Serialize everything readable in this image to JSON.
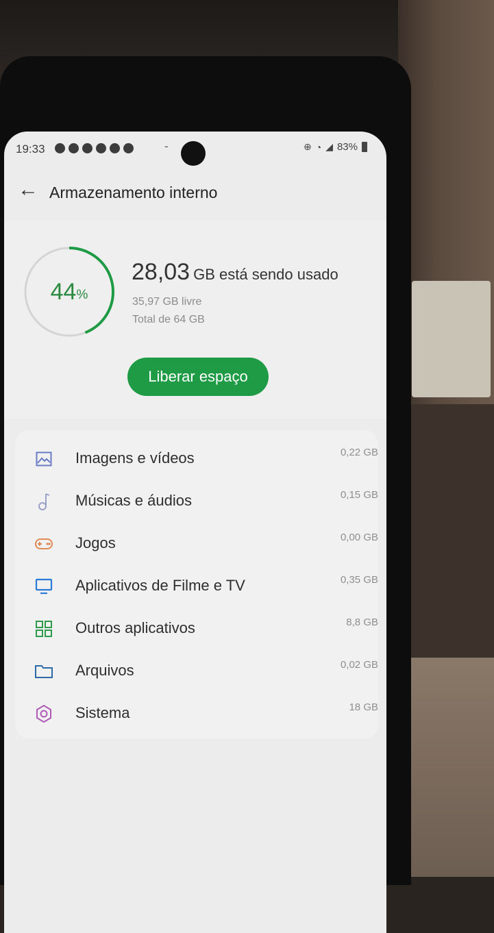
{
  "status_bar": {
    "time": "19:33",
    "separator": "-",
    "battery": "83%"
  },
  "header": {
    "title": "Armazenamento interno"
  },
  "summary": {
    "percent_value": "44",
    "percent_sign": "%",
    "used_amount": "28,03",
    "used_text": "GB está sendo usado",
    "free_text": "35,97 GB livre",
    "total_text": "Total de 64 GB",
    "used_fraction": 0.44,
    "free_space_button": "Liberar espaço"
  },
  "categories": [
    {
      "label": "Imagens e vídeos",
      "size": "0,22 GB",
      "icon": "image-icon",
      "color": "#6b7bc6"
    },
    {
      "label": "Músicas e áudios",
      "size": "0,15 GB",
      "icon": "music-note-icon",
      "color": "#9aa0c8"
    },
    {
      "label": "Jogos",
      "size": "0,00 GB",
      "icon": "gamepad-icon",
      "color": "#e08a56"
    },
    {
      "label": "Aplicativos de Filme e TV",
      "size": "0,35 GB",
      "icon": "tv-icon",
      "color": "#2b7bd6"
    },
    {
      "label": "Outros aplicativos",
      "size": "8,8 GB",
      "icon": "apps-grid-icon",
      "color": "#2e9a4a"
    },
    {
      "label": "Arquivos",
      "size": "0,02 GB",
      "icon": "folder-icon",
      "color": "#2e6aa6"
    },
    {
      "label": "Sistema",
      "size": "18 GB",
      "icon": "gear-icon",
      "color": "#b05ab8"
    }
  ],
  "colors": {
    "accent": "#1f9a45",
    "ring_track": "#d4d4d4"
  }
}
